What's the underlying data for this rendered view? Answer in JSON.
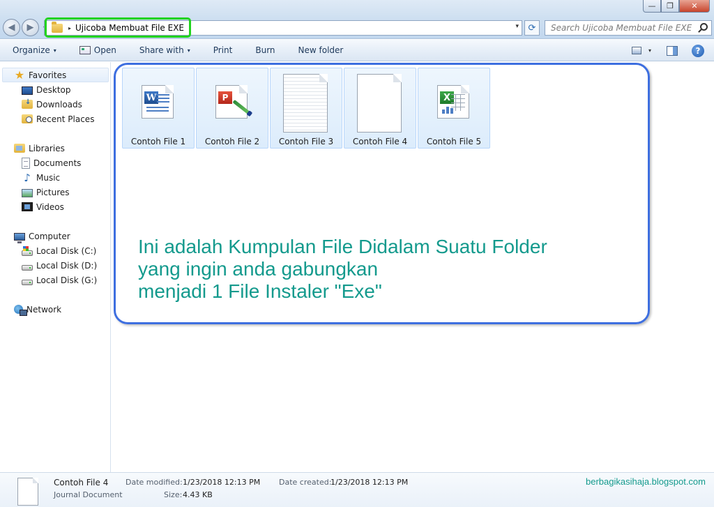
{
  "window": {
    "minimize_glyph": "—",
    "restore_glyph": "❐",
    "close_glyph": "✕"
  },
  "nav": {
    "back_glyph": "◀",
    "forward_glyph": "▶",
    "recent_glyph": "▾"
  },
  "address": {
    "path_arrow": "▸",
    "path": "Ujicoba Membuat File EXE",
    "dropdown_glyph": "▾",
    "refresh_glyph": "⟳"
  },
  "search": {
    "placeholder": "Search Ujicoba Membuat File EXE"
  },
  "toolbar": {
    "organize": "Organize",
    "open": "Open",
    "share_with": "Share with",
    "print": "Print",
    "burn": "Burn",
    "new_folder": "New folder",
    "caret": "▾",
    "help": "?"
  },
  "sidebar": {
    "favorites": {
      "label": "Favorites",
      "star": "★",
      "items": [
        "Desktop",
        "Downloads",
        "Recent Places"
      ]
    },
    "libraries": {
      "label": "Libraries",
      "items": [
        "Documents",
        "Music",
        "Pictures",
        "Videos"
      ],
      "music_glyph": "♪"
    },
    "computer": {
      "label": "Computer",
      "items": [
        "Local Disk (C:)",
        "Local Disk (D:)",
        "Local Disk (G:)"
      ]
    },
    "network": {
      "label": "Network"
    }
  },
  "files": [
    {
      "name": "Contoh File 1",
      "type": "word",
      "badge": "W"
    },
    {
      "name": "Contoh File 2",
      "type": "powerpoint",
      "badge": "P"
    },
    {
      "name": "Contoh File 3",
      "type": "text"
    },
    {
      "name": "Contoh File 4",
      "type": "blank"
    },
    {
      "name": "Contoh File 5",
      "type": "excel",
      "badge": "X"
    }
  ],
  "annotation": {
    "line1": "Ini adalah Kumpulan File Didalam Suatu Folder",
    "line2": "yang ingin anda gabungkan",
    "line3": "menjadi 1 File Instaler \"Exe\""
  },
  "details": {
    "name": "Contoh File 4",
    "type": "Journal Document",
    "date_modified_label": "Date modified:",
    "date_modified": "1/23/2018 12:13 PM",
    "date_created_label": "Date created:",
    "date_created": "1/23/2018 12:13 PM",
    "size_label": "Size:",
    "size": "4.43 KB"
  },
  "watermark": "berbagikasihaja.blogspot.com",
  "colors": {
    "callout_border": "#3e6fe0",
    "callout_text": "#149a8d",
    "address_highlight": "#22d31e"
  }
}
